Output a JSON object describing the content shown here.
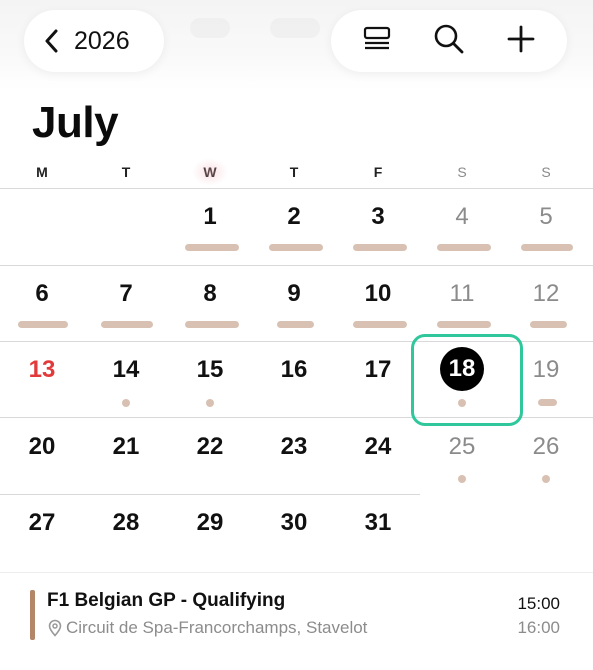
{
  "header": {
    "back_label": "2026",
    "back_icon": "chevron-left-icon",
    "actions": [
      {
        "name": "list-view-button",
        "icon": "list-icon"
      },
      {
        "name": "search-button",
        "icon": "search-icon"
      },
      {
        "name": "add-event-button",
        "icon": "plus-icon"
      }
    ]
  },
  "month": {
    "title": "July",
    "weekdays": [
      "M",
      "T",
      "W",
      "T",
      "F",
      "S",
      "S"
    ],
    "today": "18",
    "weeks": [
      [
        "",
        "",
        "1",
        "2",
        "3",
        "4",
        "5"
      ],
      [
        "6",
        "7",
        "8",
        "9",
        "10",
        "11",
        "12"
      ],
      [
        "13",
        "14",
        "15",
        "16",
        "17",
        "18",
        "19"
      ],
      [
        "20",
        "21",
        "22",
        "23",
        "24",
        "25",
        "26"
      ],
      [
        "27",
        "28",
        "29",
        "30",
        "31",
        "",
        ""
      ]
    ]
  },
  "event": {
    "title": "F1 Belgian GP - Qualifying",
    "location": "Circuit de Spa-Francorchamps, Stavelot",
    "start": "15:00",
    "end": "16:00"
  },
  "colors": {
    "today_highlight": "#2fc79b",
    "event_marker": "#d8c1b3",
    "event_accent": "#b28667",
    "holiday_red": "#e23a3a"
  }
}
